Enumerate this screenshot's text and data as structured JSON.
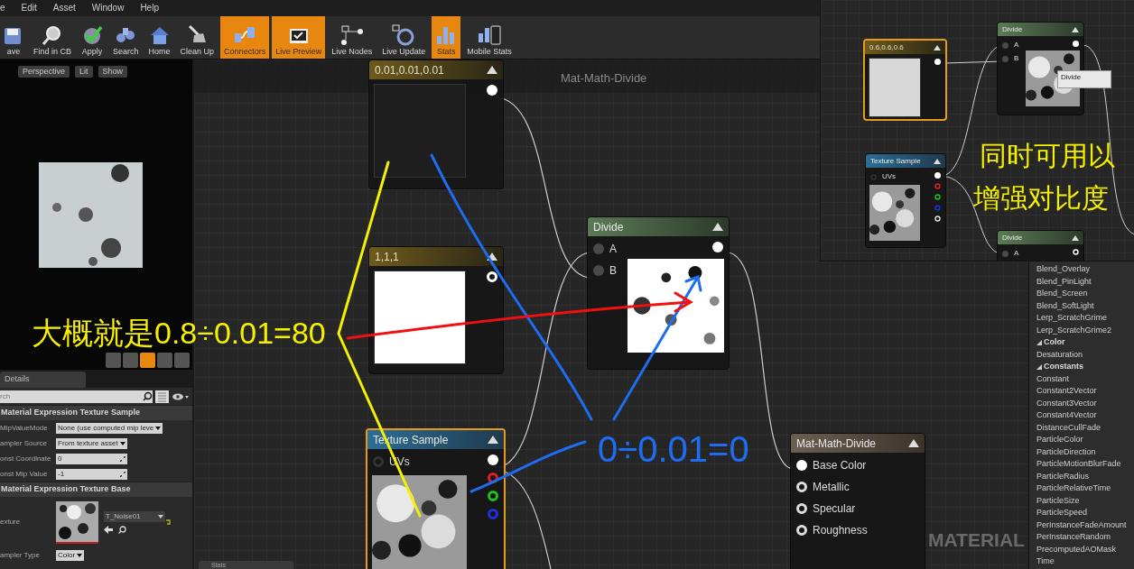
{
  "menu": [
    "e",
    "Edit",
    "Asset",
    "Window",
    "Help"
  ],
  "toolbar": [
    {
      "label": "ave",
      "active": false
    },
    {
      "label": "Find in CB",
      "active": false
    },
    {
      "label": "Apply",
      "active": false
    },
    {
      "label": "Search",
      "active": false
    },
    {
      "label": "Home",
      "active": false
    },
    {
      "label": "Clean Up",
      "active": false
    },
    {
      "label": "Connectors",
      "active": true
    },
    {
      "label": "Live Preview",
      "active": true
    },
    {
      "label": "Live Nodes",
      "active": false
    },
    {
      "label": "Live Update",
      "active": false
    },
    {
      "label": "Stats",
      "active": true
    },
    {
      "label": "Mobile Stats",
      "active": false
    }
  ],
  "viewport": {
    "buttons": [
      "Perspective",
      "Lit",
      "Show"
    ],
    "preview_shapes": [
      {
        "selected": false
      },
      {
        "selected": false
      },
      {
        "selected": true
      },
      {
        "selected": false
      },
      {
        "selected": false
      }
    ]
  },
  "details": {
    "tab": "Details",
    "search": {
      "placeholder": "rch"
    },
    "sections": [
      {
        "title": "Material Expression Texture Sample",
        "rows": [
          {
            "label": "MipValueMode",
            "kind": "dropdown",
            "value": "None (use computed mip leve"
          },
          {
            "label": "ampler Source",
            "kind": "dropdown",
            "value": "From texture asset"
          },
          {
            "label": "onst Coordinate",
            "kind": "number",
            "value": "0"
          },
          {
            "label": "onst Mip Value",
            "kind": "number",
            "value": "-1"
          }
        ]
      },
      {
        "title": "Material Expression Texture Base",
        "rows": [
          {
            "label": "exture",
            "kind": "asset",
            "value": "T_Noise01"
          },
          {
            "label": "ampler Type",
            "kind": "dropdown",
            "value": "Color"
          }
        ]
      }
    ]
  },
  "graph": {
    "title": "Mat-Math-Divide",
    "corner_text": "MATERIAL",
    "bottom_tab": "Stats",
    "nodes": [
      {
        "title": "0.01,0.01,0.01",
        "kind": "constant",
        "selected": false,
        "outputs": [
          {
            "color": "#ffffff",
            "connected": true
          }
        ],
        "preview": {
          "kind": "swatch",
          "color": "#1e1e1e"
        }
      },
      {
        "title": "1,1,1",
        "kind": "constant",
        "selected": false,
        "outputs": [
          {
            "color": "#ffffff",
            "connected": false
          }
        ],
        "preview": {
          "kind": "swatch",
          "color": "#ffffff"
        }
      },
      {
        "title": "Divide",
        "kind": "math",
        "selected": false,
        "inputs": [
          {
            "label": "A",
            "color": "#4a4a4a",
            "connected": true
          },
          {
            "label": "B",
            "color": "#4a4a4a",
            "connected": true
          }
        ],
        "outputs": [
          {
            "color": "#ffffff",
            "connected": true
          }
        ],
        "preview": {
          "kind": "divided"
        }
      },
      {
        "title": "Texture Sample",
        "kind": "texture",
        "selected": true,
        "inputs": [
          {
            "label": "UVs",
            "color": "#333333",
            "connected": false
          }
        ],
        "outputs": [
          {
            "color": "#ffffff",
            "connected": true
          },
          {
            "color": "#e02020",
            "connected": false
          },
          {
            "color": "#20c020",
            "connected": false
          },
          {
            "color": "#2030e0",
            "connected": false
          }
        ],
        "preview": {
          "kind": "noise"
        }
      },
      {
        "title": "Mat-Math-Divide",
        "kind": "result",
        "selected": false,
        "inputs": [
          {
            "label": "Base Color",
            "color": "#ffffff",
            "connected": true
          },
          {
            "label": "Metallic",
            "color": "#dddddd",
            "connected": false
          },
          {
            "label": "Specular",
            "color": "#dddddd",
            "connected": false
          },
          {
            "label": "Roughness",
            "color": "#dddddd",
            "connected": false
          }
        ]
      }
    ]
  },
  "inset": {
    "tooltip": "Divide",
    "nodes": [
      {
        "title": "0.6,0.6,0.6",
        "kind": "constant",
        "selected": true,
        "outputs": [
          {
            "color": "#ffffff",
            "connected": true
          }
        ],
        "preview": {
          "kind": "swatch",
          "color": "#d8d8d8"
        }
      },
      {
        "title": "Divide",
        "kind": "math",
        "selected": false,
        "inputs": [
          {
            "label": "A",
            "color": "#4a4a4a",
            "connected": true
          },
          {
            "label": "B",
            "color": "#4a4a4a",
            "connected": true
          }
        ],
        "outputs": [
          {
            "color": "#ffffff",
            "connected": true
          }
        ],
        "preview": {
          "kind": "noise"
        }
      },
      {
        "title": "Texture Sample",
        "kind": "texture",
        "selected": false,
        "inputs": [
          {
            "label": "UVs",
            "color": "#333333",
            "connected": false
          }
        ],
        "outputs": [
          {
            "color": "#ffffff",
            "connected": true
          },
          {
            "color": "#e02020",
            "connected": false
          },
          {
            "color": "#20c020",
            "connected": false
          },
          {
            "color": "#2030e0",
            "connected": false
          },
          {
            "color": "#dddddd",
            "connected": false
          }
        ],
        "preview": {
          "kind": "noise"
        }
      },
      {
        "title": "Divide",
        "kind": "math",
        "selected": false,
        "inputs": [
          {
            "label": "A",
            "color": "#4a4a4a",
            "connected": true
          }
        ],
        "outputs": [
          {
            "color": "#ffffff",
            "connected": false
          }
        ]
      }
    ]
  },
  "palette": {
    "items": [
      {
        "label": "Blend_Overlay"
      },
      {
        "label": "Blend_PinLight"
      },
      {
        "label": "Blend_Screen"
      },
      {
        "label": "Blend_SoftLight"
      },
      {
        "label": "Lerp_ScratchGrime"
      },
      {
        "label": "Lerp_ScratchGrime2"
      },
      {
        "label": "Color",
        "expanded": true,
        "children": [
          {
            "label": "Desaturation"
          }
        ]
      },
      {
        "label": "Constants",
        "expanded": true,
        "children": [
          {
            "label": "Constant"
          },
          {
            "label": "Constant2Vector"
          },
          {
            "label": "Constant3Vector"
          },
          {
            "label": "Constant4Vector"
          },
          {
            "label": "DistanceCullFade"
          },
          {
            "label": "ParticleColor"
          },
          {
            "label": "ParticleDirection"
          },
          {
            "label": "ParticleMotionBlurFade"
          },
          {
            "label": "ParticleRadius"
          },
          {
            "label": "ParticleRelativeTime"
          },
          {
            "label": "ParticleSize"
          },
          {
            "label": "ParticleSpeed"
          },
          {
            "label": "PerInstanceFadeAmount"
          },
          {
            "label": "PerInstanceRandom"
          },
          {
            "label": "PrecomputedAOMask"
          },
          {
            "label": "Time"
          }
        ]
      }
    ]
  },
  "annotations": [
    {
      "text": "大概就是0.8÷0.01=80",
      "color": "#f5f000"
    },
    {
      "text": "0÷0.01=0",
      "color": "#1e6cf0"
    },
    {
      "text": "同时可用以",
      "color": "#f5f000"
    },
    {
      "text": "增强对比度",
      "color": "#f5f000"
    }
  ]
}
